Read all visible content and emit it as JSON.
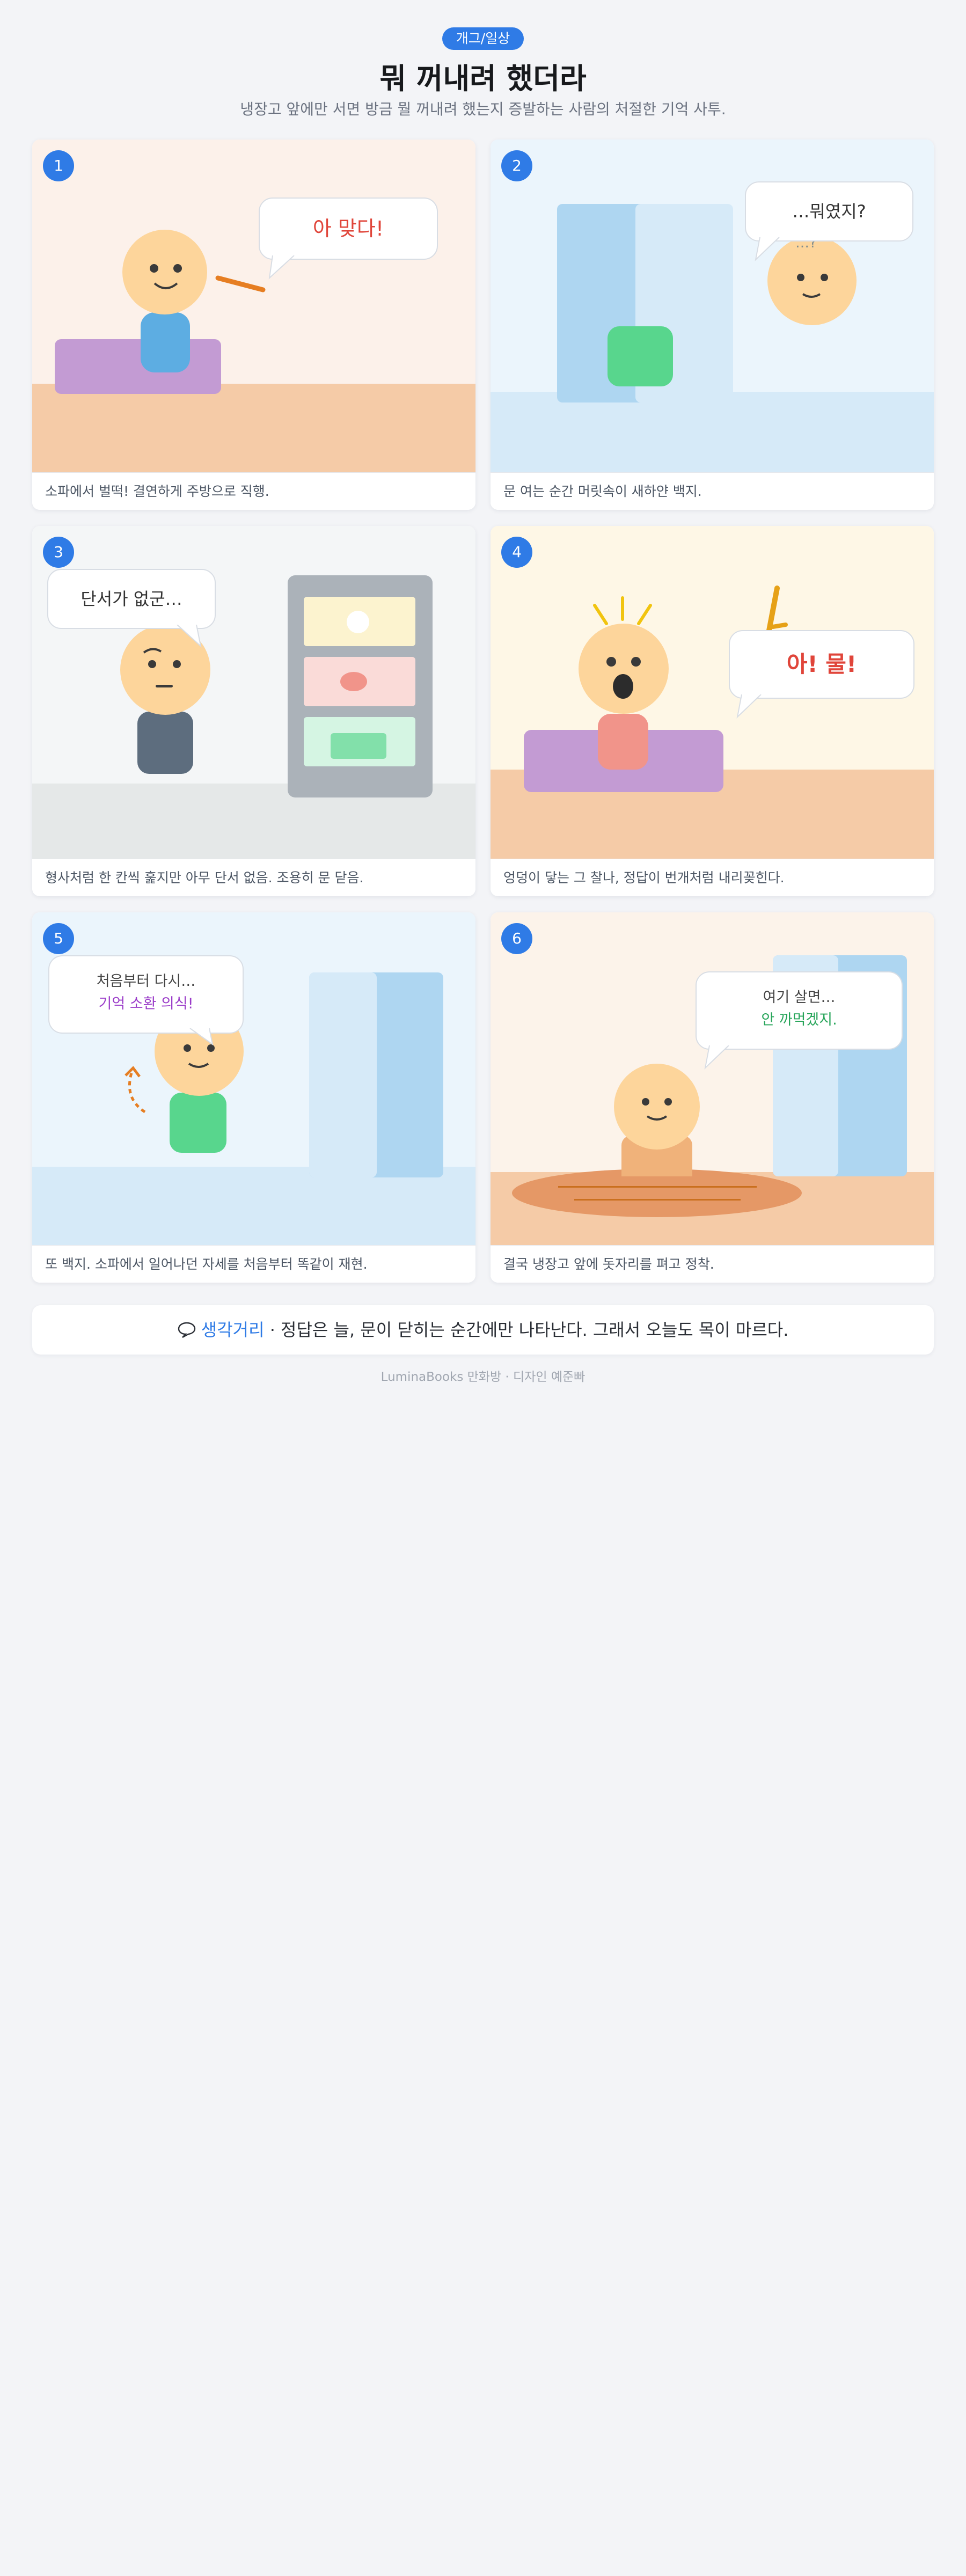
{
  "header": {
    "badge": "개그/일상",
    "title": "뭐 꺼내려 했더라",
    "subtitle": "냉장고 앞에만 서면 방금 뭘 꺼내려 했는지 증발하는 사람의 처절한 기억 사투."
  },
  "panels": [
    {
      "number": "1",
      "bubble": "아 맞다!",
      "caption": "소파에서 벌떡! 결연하게 주방으로 직행."
    },
    {
      "number": "2",
      "bubble": "…뭐였지?",
      "mark": "…?",
      "caption": "문 여는 순간 머릿속이 새하얀 백지."
    },
    {
      "number": "3",
      "bubble": "단서가 없군…",
      "caption": "형사처럼 한 칸씩 훑지만 아무 단서 없음. 조용히 문 닫음."
    },
    {
      "number": "4",
      "bubble": "아! 물!",
      "caption": "엉덩이 닿는 그 찰나, 정답이 번개처럼 내리꽂힌다."
    },
    {
      "number": "5",
      "bubble_line1": "처음부터 다시…",
      "bubble_line2": "기억 소환 의식!",
      "caption": "또 백지. 소파에서 일어나던 자세를 처음부터 똑같이 재현."
    },
    {
      "number": "6",
      "bubble_line1": "여기 살면…",
      "bubble_line2": "안 까먹겠지.",
      "caption": "결국 냉장고 앞에 돗자리를 펴고 정착."
    }
  ],
  "thought": {
    "icon": "thought-bubble-icon",
    "label": "생각거리",
    "separator": "·",
    "text": "정답은 늘, 문이 닫히는 순간에만 나타난다. 그래서 오늘도 목이 마르다."
  },
  "footer": "LuminaBooks 만화방 · 디자인 예준빠",
  "colors": {
    "accent": "#2f7be6",
    "red_text": "#e0453a",
    "purple_text": "#9b3dc9",
    "green_text": "#27a55a",
    "sofa": "#c39bd3",
    "fridge": "#aed6f1",
    "floor_warm": "#f5cba7",
    "skin": "#fdd59b"
  }
}
